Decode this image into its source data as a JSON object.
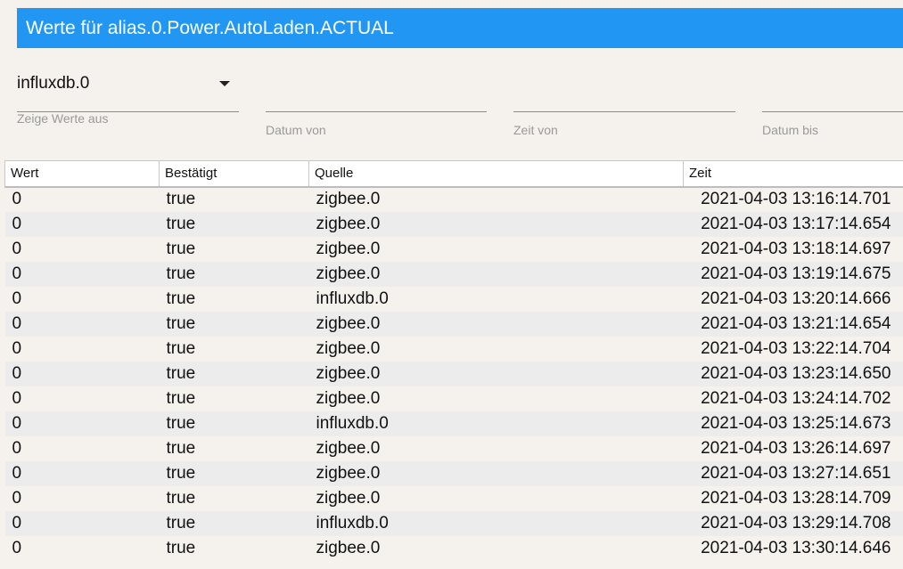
{
  "title": "Werte für alias.0.Power.AutoLaden.ACTUAL",
  "instance_select": {
    "value": "influxdb.0",
    "helper": "Zeige Werte aus"
  },
  "filters": {
    "date_from": "Datum von",
    "time_from": "Zeit von",
    "date_to": "Datum bis"
  },
  "table": {
    "headers": [
      "Wert",
      "Bestätigt",
      "Quelle",
      "Zeit"
    ],
    "rows": [
      [
        "0",
        "true",
        "zigbee.0",
        "2021-04-03 13:16:14.701"
      ],
      [
        "0",
        "true",
        "zigbee.0",
        "2021-04-03 13:17:14.654"
      ],
      [
        "0",
        "true",
        "zigbee.0",
        "2021-04-03 13:18:14.697"
      ],
      [
        "0",
        "true",
        "zigbee.0",
        "2021-04-03 13:19:14.675"
      ],
      [
        "0",
        "true",
        "influxdb.0",
        "2021-04-03 13:20:14.666"
      ],
      [
        "0",
        "true",
        "zigbee.0",
        "2021-04-03 13:21:14.654"
      ],
      [
        "0",
        "true",
        "zigbee.0",
        "2021-04-03 13:22:14.704"
      ],
      [
        "0",
        "true",
        "zigbee.0",
        "2021-04-03 13:23:14.650"
      ],
      [
        "0",
        "true",
        "zigbee.0",
        "2021-04-03 13:24:14.702"
      ],
      [
        "0",
        "true",
        "influxdb.0",
        "2021-04-03 13:25:14.673"
      ],
      [
        "0",
        "true",
        "zigbee.0",
        "2021-04-03 13:26:14.697"
      ],
      [
        "0",
        "true",
        "zigbee.0",
        "2021-04-03 13:27:14.651"
      ],
      [
        "0",
        "true",
        "zigbee.0",
        "2021-04-03 13:28:14.709"
      ],
      [
        "0",
        "true",
        "influxdb.0",
        "2021-04-03 13:29:14.708"
      ],
      [
        "0",
        "true",
        "zigbee.0",
        "2021-04-03 13:30:14.646"
      ]
    ]
  }
}
